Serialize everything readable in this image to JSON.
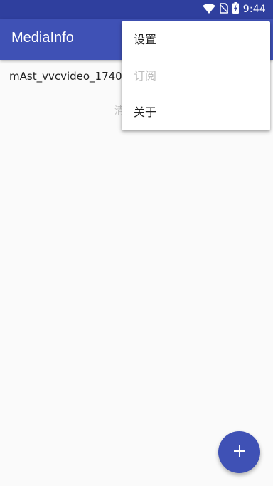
{
  "status_bar": {
    "time": "9:44",
    "icons": [
      "wifi-icon",
      "no-sim-icon",
      "battery-charging-icon"
    ]
  },
  "app_bar": {
    "title": "MediaInfo"
  },
  "content": {
    "file_name": "mAst_vvcvideo_1740",
    "hint_text": "清"
  },
  "overflow_menu": {
    "items": [
      {
        "label": "设置",
        "enabled": true
      },
      {
        "label": "订阅",
        "enabled": false
      },
      {
        "label": "关于",
        "enabled": true
      }
    ]
  },
  "fab": {
    "icon": "plus-icon"
  },
  "colors": {
    "primary": "#3f51b5",
    "primary_dark": "#2f3f9e",
    "background": "#fafafa"
  }
}
